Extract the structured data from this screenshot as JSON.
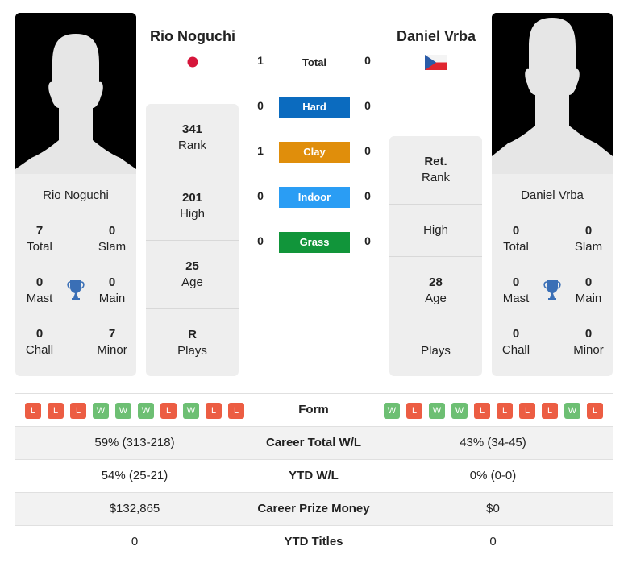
{
  "player1": {
    "name": "Rio Noguchi",
    "flag": "japan-flag",
    "card_name": "Rio Noguchi",
    "titles": [
      {
        "value": "7",
        "label": "Total"
      },
      {
        "value": "0",
        "label": "Slam"
      },
      {
        "value": "0",
        "label": "Mast"
      },
      {
        "value": "0",
        "label": "Main"
      },
      {
        "value": "0",
        "label": "Chall"
      },
      {
        "value": "7",
        "label": "Minor"
      }
    ],
    "stats": [
      {
        "value": "341",
        "label": "Rank"
      },
      {
        "value": "201",
        "label": "High"
      },
      {
        "value": "25",
        "label": "Age"
      },
      {
        "value": "R",
        "label": "Plays"
      }
    ],
    "form": [
      "L",
      "L",
      "L",
      "W",
      "W",
      "W",
      "L",
      "W",
      "L",
      "L"
    ]
  },
  "player2": {
    "name": "Daniel Vrba",
    "flag": "czech-flag",
    "card_name": "Daniel Vrba",
    "titles": [
      {
        "value": "0",
        "label": "Total"
      },
      {
        "value": "0",
        "label": "Slam"
      },
      {
        "value": "0",
        "label": "Mast"
      },
      {
        "value": "0",
        "label": "Main"
      },
      {
        "value": "0",
        "label": "Chall"
      },
      {
        "value": "0",
        "label": "Minor"
      }
    ],
    "stats": [
      {
        "value": "Ret.",
        "label": "Rank"
      },
      {
        "value": "",
        "label": "High"
      },
      {
        "value": "28",
        "label": "Age"
      },
      {
        "value": "",
        "label": "Plays"
      }
    ],
    "form": [
      "W",
      "L",
      "W",
      "W",
      "L",
      "L",
      "L",
      "L",
      "W",
      "L"
    ]
  },
  "h2h": {
    "total": {
      "label": "Total",
      "p1": "1",
      "p2": "0"
    },
    "surfaces": [
      {
        "label": "Hard",
        "p1": "0",
        "p2": "0",
        "color": "#0b6bbf"
      },
      {
        "label": "Clay",
        "p1": "1",
        "p2": "0",
        "color": "#e08e0b"
      },
      {
        "label": "Indoor",
        "p1": "0",
        "p2": "0",
        "color": "#2a9df4"
      },
      {
        "label": "Grass",
        "p1": "0",
        "p2": "0",
        "color": "#11953a"
      }
    ]
  },
  "comparison": {
    "form_label": "Form",
    "rows": [
      {
        "label": "Career Total W/L",
        "p1": "59% (313-218)",
        "p2": "43% (34-45)"
      },
      {
        "label": "YTD W/L",
        "p1": "54% (25-21)",
        "p2": "0% (0-0)"
      },
      {
        "label": "Career Prize Money",
        "p1": "$132,865",
        "p2": "$0"
      },
      {
        "label": "YTD Titles",
        "p1": "0",
        "p2": "0"
      }
    ]
  },
  "colors": {
    "win": "#6dbf73",
    "loss": "#ec5d43",
    "trophy": "#3a6fb6"
  }
}
